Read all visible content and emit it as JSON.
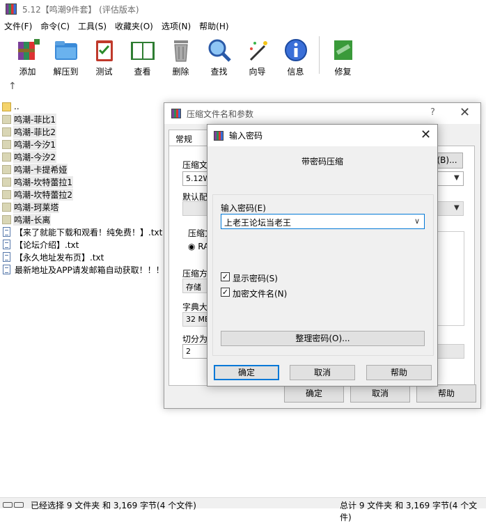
{
  "window": {
    "title": "5.12【鸣潮9件套】 (评估版本)"
  },
  "menu": [
    "文件(F)",
    "命令(C)",
    "工具(S)",
    "收藏夹(O)",
    "选项(N)",
    "帮助(H)"
  ],
  "toolbar": [
    {
      "label": "添加",
      "icon": "add-archive-icon"
    },
    {
      "label": "解压到",
      "icon": "extract-folder-icon"
    },
    {
      "label": "测试",
      "icon": "test-clipboard-icon"
    },
    {
      "label": "查看",
      "icon": "view-book-icon"
    },
    {
      "label": "删除",
      "icon": "trash-icon"
    },
    {
      "label": "查找",
      "icon": "magnifier-icon"
    },
    {
      "label": "向导",
      "icon": "wizard-wand-icon"
    },
    {
      "label": "信息",
      "icon": "info-icon"
    },
    {
      "label": "修复",
      "icon": "repair-icon"
    }
  ],
  "up_arrow": "↑",
  "files": [
    {
      "name": "..",
      "type": "up"
    },
    {
      "name": "鸣潮-菲比1",
      "type": "folder"
    },
    {
      "name": "鸣潮-菲比2",
      "type": "folder"
    },
    {
      "name": "鸣潮-今汐1",
      "type": "folder"
    },
    {
      "name": "鸣潮-今汐2",
      "type": "folder"
    },
    {
      "name": "鸣潮-卡提希娅",
      "type": "folder"
    },
    {
      "name": "鸣潮-坎特蕾拉1",
      "type": "folder"
    },
    {
      "name": "鸣潮-坎特蕾拉2",
      "type": "folder"
    },
    {
      "name": "鸣潮-珂莱塔",
      "type": "folder"
    },
    {
      "name": "鸣潮-长离",
      "type": "folder"
    },
    {
      "name": "【来了就能下载和观看！纯免费！】.txt",
      "type": "txt"
    },
    {
      "name": "【论坛介绍】.txt",
      "type": "txt"
    },
    {
      "name": "【永久地址发布页】.txt",
      "type": "txt"
    },
    {
      "name": "最新地址及APP请发邮箱自动获取！！！.",
      "type": "txt"
    }
  ],
  "status": {
    "left": "已经选择 9 文件夹 和 3,169 字节(4 个文件)",
    "right": "总计 9 文件夹 和 3,169 字节(4 个文件)"
  },
  "archive_dialog": {
    "title": "压缩文件名和参数",
    "help": "?",
    "close": "✕",
    "tab": "常规",
    "label_name": "压缩文",
    "name_value": "5.12W",
    "browse": "(B)...",
    "label_default": "默认配",
    "label_format": "压缩文",
    "format_radio": "RA",
    "label_method": "压缩方",
    "method_value": "存储",
    "label_dict": "字典大",
    "dict_value": "32 MB",
    "label_split": "切分为",
    "split_value": "2",
    "ok": "确定",
    "cancel": "取消",
    "help_btn": "帮助"
  },
  "password_dialog": {
    "title": "输入密码",
    "close": "✕",
    "heading": "带密码压缩",
    "label_password": "输入密码(E)",
    "password_value": "上老王论坛当老王",
    "show_password": "显示密码(S)",
    "encrypt_names": "加密文件名(N)",
    "organize": "整理密码(O)...",
    "ok": "确定",
    "cancel": "取消",
    "help": "帮助"
  }
}
